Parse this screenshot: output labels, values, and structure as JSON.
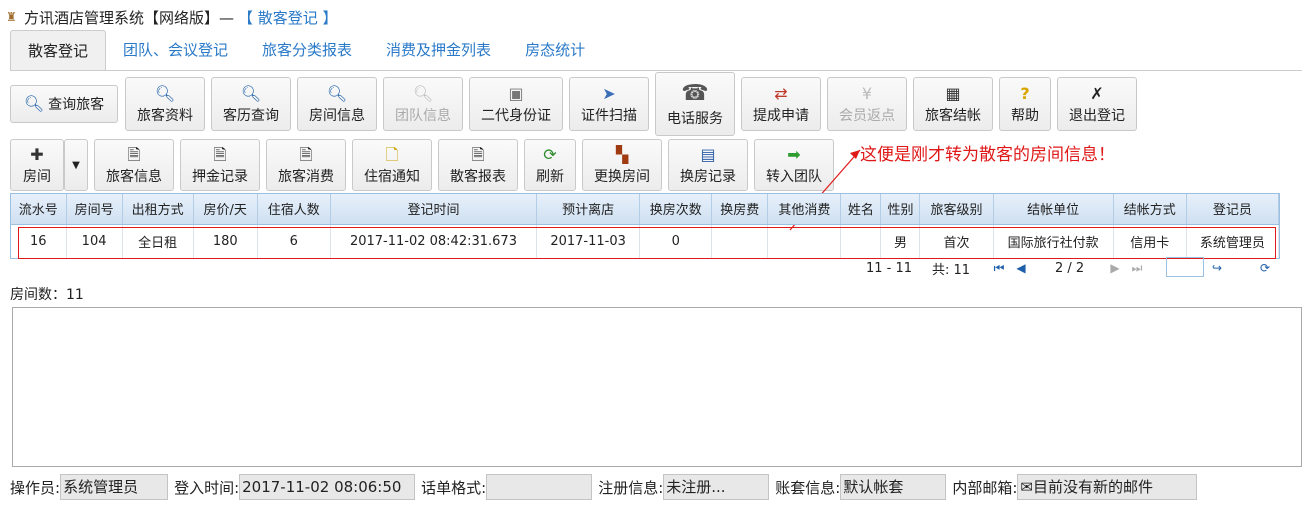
{
  "window": {
    "app_title": "方讯酒店管理系统【网络版】—",
    "page_title": "【 散客登记 】"
  },
  "tabs": [
    "散客登记",
    "团队、会议登记",
    "旅客分类报表",
    "消费及押金列表",
    "房态统计"
  ],
  "toolbar1": {
    "search": "查询旅客",
    "items": [
      "旅客资料",
      "客历查询",
      "房间信息",
      "团队信息",
      "二代身份证",
      "证件扫描",
      "电话服务",
      "提成申请",
      "会员返点",
      "旅客结帐",
      "帮助",
      "退出登记"
    ]
  },
  "toolbar2": {
    "room": "房间",
    "items": [
      "旅客信息",
      "押金记录",
      "旅客消费",
      "住宿通知",
      "散客报表",
      "刷新",
      "更换房间",
      "换房记录",
      "转入团队"
    ]
  },
  "annotation": "这便是刚才转为散客的房间信息！",
  "grid": {
    "headers": [
      "流水号",
      "房间号",
      "出租方式",
      "房价/天",
      "住宿人数",
      "登记时间",
      "预计离店",
      "换房次数",
      "换房费",
      "其他消费",
      "姓名",
      "性别",
      "旅客级别",
      "结帐单位",
      "结帐方式",
      "登记员"
    ],
    "rows": [
      [
        "16",
        "104",
        "全日租",
        "180",
        "6",
        "2017-11-02 08:42:31.673",
        "2017-11-03",
        "0",
        "",
        "",
        "",
        "男",
        "首次",
        "国际旅行社付款",
        "信用卡",
        "系统管理员"
      ]
    ]
  },
  "pager": {
    "range": "11 - 11",
    "total": "共: 11",
    "page": "2 / 2"
  },
  "room_count": "房间数：11",
  "status": {
    "operator_label": "操作员:",
    "operator": "系统管理员",
    "login_label": "登入时间:",
    "login": "2017-11-02 08:06:50",
    "format_label": "话单格式:",
    "format": "",
    "reg_label": "注册信息:",
    "reg": "未注册...",
    "book_label": "账套信息:",
    "book": "默认帐套",
    "mail_label": "内部邮箱:",
    "mail": "目前没有新的邮件"
  },
  "colors": {
    "link": "#2a7ac8",
    "annotation": "#e01818",
    "grid_header": "#cfe0f2"
  }
}
